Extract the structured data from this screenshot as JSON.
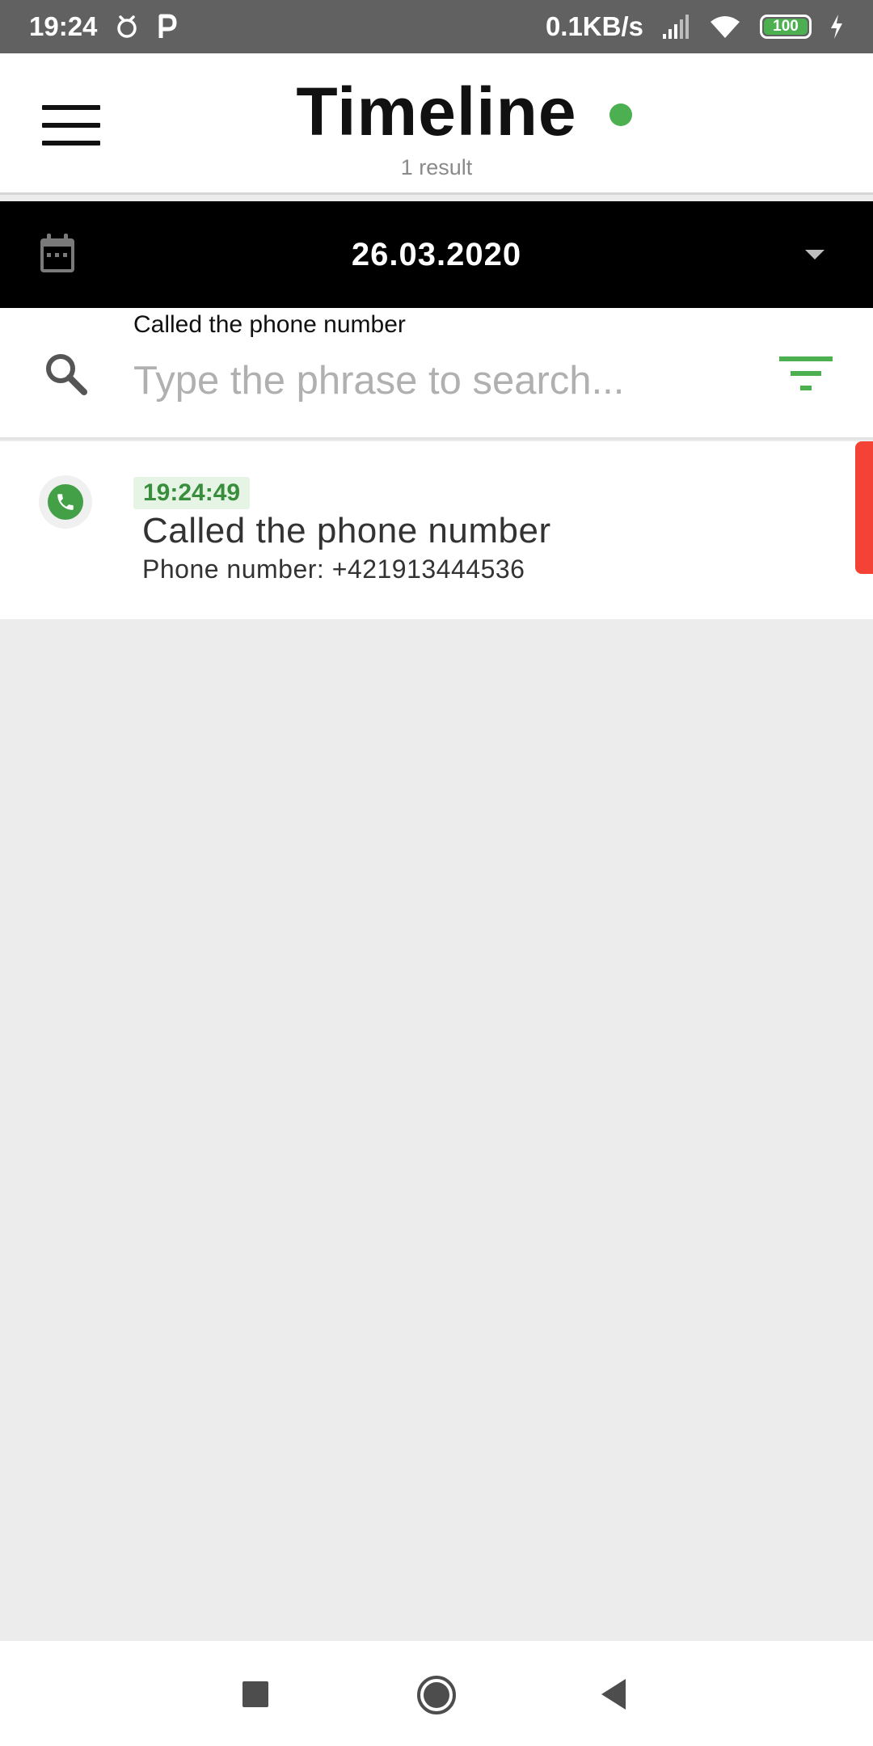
{
  "status_bar": {
    "time": "19:24",
    "speed": "0.1KB/s",
    "battery": "100"
  },
  "header": {
    "title": "Timeline",
    "subtitle": "1 result"
  },
  "date_bar": {
    "date": "26.03.2020"
  },
  "search": {
    "label": "Called the phone number",
    "placeholder": "Type the phrase to search..."
  },
  "timeline": {
    "items": [
      {
        "time": "19:24:49",
        "title": "Called the phone number",
        "detail": "Phone number: +421913444536",
        "icon": "phone-icon"
      }
    ]
  },
  "colors": {
    "accent": "#4caf50",
    "marker": "#f44336",
    "status_bar": "#616161",
    "date_bar": "#000000"
  }
}
